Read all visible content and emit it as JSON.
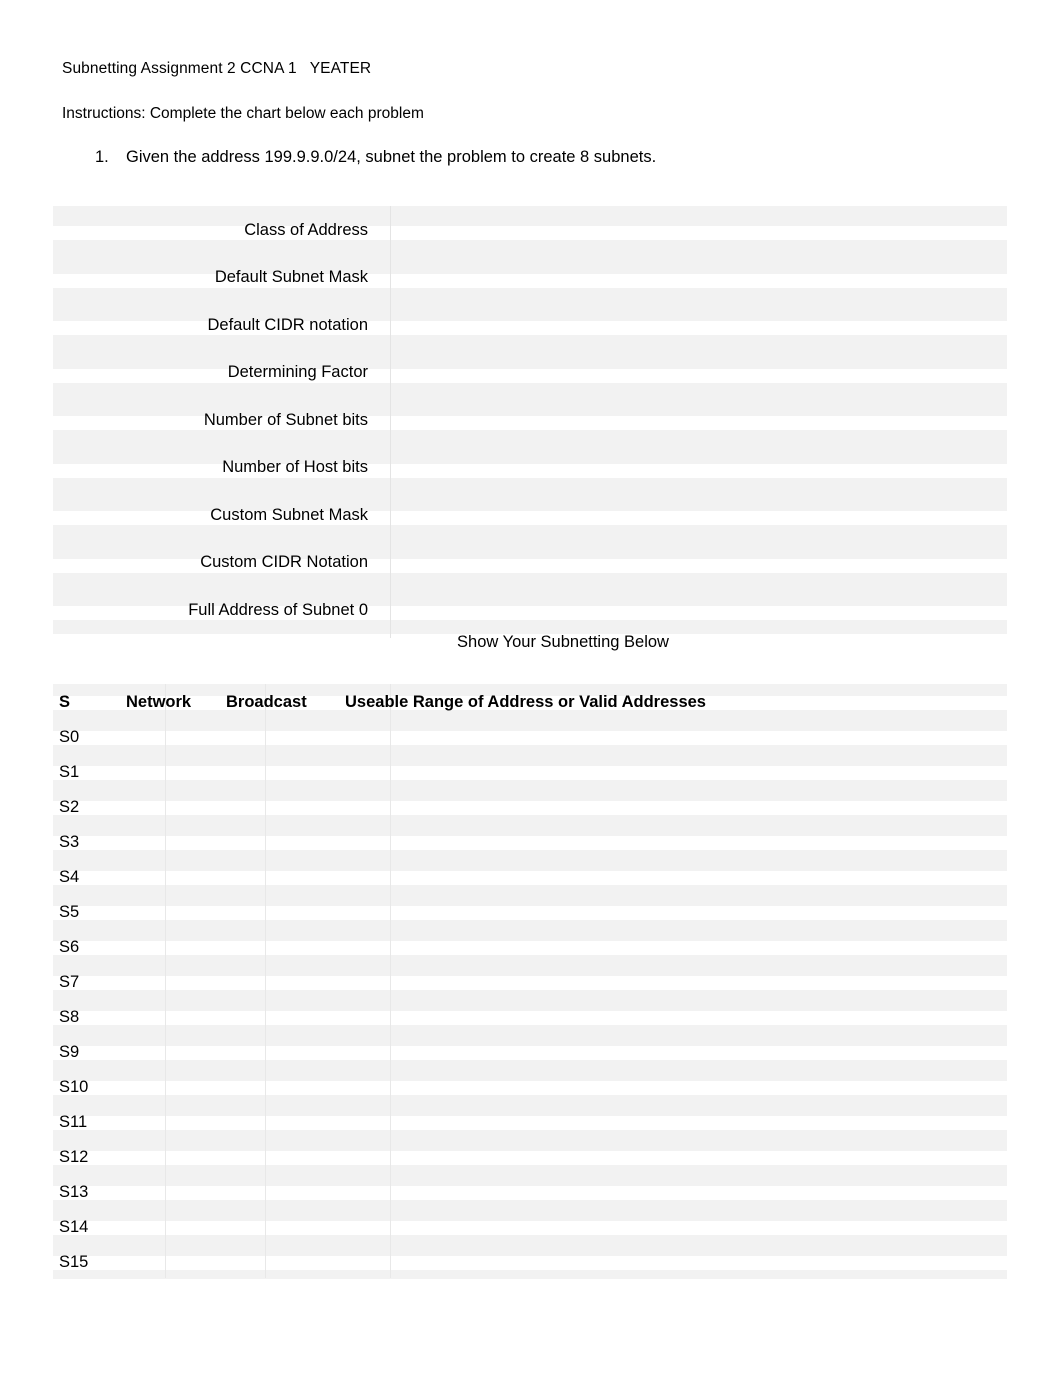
{
  "document": {
    "title": "Subnetting Assignment 2 CCNA 1   YEATER",
    "instructions": "Instructions: Complete the chart below each problem",
    "caption": "Show Your Subnetting Below"
  },
  "problems": [
    {
      "number": "1.",
      "text": "Given the address 199.9.9.0/24, subnet the problem to create 8 subnets."
    }
  ],
  "attribute_table": {
    "rows": [
      {
        "label": "Class of Address",
        "value": ""
      },
      {
        "label": "Default Subnet Mask",
        "value": ""
      },
      {
        "label": "Default CIDR notation",
        "value": ""
      },
      {
        "label": "Determining Factor",
        "value": ""
      },
      {
        "label": "Number of Subnet bits",
        "value": ""
      },
      {
        "label": "Number of Host bits",
        "value": ""
      },
      {
        "label": "Custom Subnet Mask",
        "value": ""
      },
      {
        "label": "Custom CIDR Notation",
        "value": ""
      },
      {
        "label": "Full Address of Subnet 0",
        "value": ""
      }
    ]
  },
  "subnet_table": {
    "headers": {
      "s": "S",
      "network": "Network",
      "broadcast": "Broadcast",
      "range": "Useable Range of Address or Valid Addresses"
    },
    "rows": [
      {
        "s": "S0",
        "network": "",
        "broadcast": "",
        "range": ""
      },
      {
        "s": "S1",
        "network": "",
        "broadcast": "",
        "range": ""
      },
      {
        "s": "S2",
        "network": "",
        "broadcast": "",
        "range": ""
      },
      {
        "s": "S3",
        "network": "",
        "broadcast": "",
        "range": ""
      },
      {
        "s": "S4",
        "network": "",
        "broadcast": "",
        "range": ""
      },
      {
        "s": "S5",
        "network": "",
        "broadcast": "",
        "range": ""
      },
      {
        "s": "S6",
        "network": "",
        "broadcast": "",
        "range": ""
      },
      {
        "s": "S7",
        "network": "",
        "broadcast": "",
        "range": ""
      },
      {
        "s": "S8",
        "network": "",
        "broadcast": "",
        "range": ""
      },
      {
        "s": "S9",
        "network": "",
        "broadcast": "",
        "range": ""
      },
      {
        "s": "S10",
        "network": "",
        "broadcast": "",
        "range": ""
      },
      {
        "s": "S11",
        "network": "",
        "broadcast": "",
        "range": ""
      },
      {
        "s": "S12",
        "network": "",
        "broadcast": "",
        "range": ""
      },
      {
        "s": "S13",
        "network": "",
        "broadcast": "",
        "range": ""
      },
      {
        "s": "S14",
        "network": "",
        "broadcast": "",
        "range": ""
      },
      {
        "s": "S15",
        "network": "",
        "broadcast": "",
        "range": ""
      }
    ]
  },
  "style": {
    "stripe_color": "#f2f2f2",
    "page_background": "#ffffff",
    "text_color": "#000000",
    "divider_color": "#e4e4e4"
  }
}
